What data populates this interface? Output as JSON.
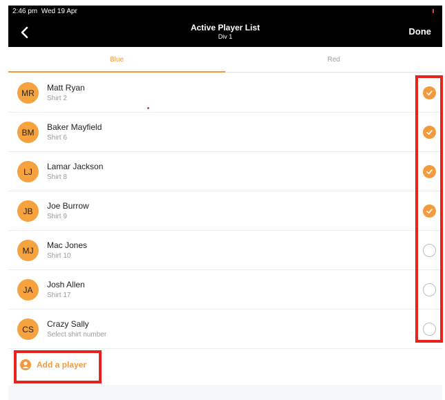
{
  "status_bar": {
    "time": "2:46 pm",
    "date": "Wed 19 Apr"
  },
  "nav": {
    "back_icon": "chevron-left-icon",
    "title": "Active Player List",
    "subtitle": "Div 1",
    "done_label": "Done"
  },
  "tabs": [
    {
      "label": "Blue",
      "active": true
    },
    {
      "label": "Red",
      "active": false
    }
  ],
  "players": [
    {
      "initials": "MR",
      "name": "Matt Ryan",
      "shirt": "Shirt 2",
      "checked": true
    },
    {
      "initials": "BM",
      "name": "Baker Mayfield",
      "shirt": "Shirt 6",
      "checked": true
    },
    {
      "initials": "LJ",
      "name": "Lamar Jackson",
      "shirt": "Shirt 8",
      "checked": true
    },
    {
      "initials": "JB",
      "name": "Joe Burrow",
      "shirt": "Shirt 9",
      "checked": true
    },
    {
      "initials": "MJ",
      "name": "Mac Jones",
      "shirt": "Shirt 10",
      "checked": false
    },
    {
      "initials": "JA",
      "name": "Josh Allen",
      "shirt": "Shirt 17",
      "checked": false
    },
    {
      "initials": "CS",
      "name": "Crazy Sally",
      "shirt": "Select shirt number",
      "checked": false
    }
  ],
  "add_player": {
    "label": "Add a player",
    "icon": "person-icon"
  },
  "colors": {
    "accent": "#f39a3d",
    "avatar": "#f6a23f",
    "highlight": "#e8231b",
    "nav_bg": "#000000"
  }
}
